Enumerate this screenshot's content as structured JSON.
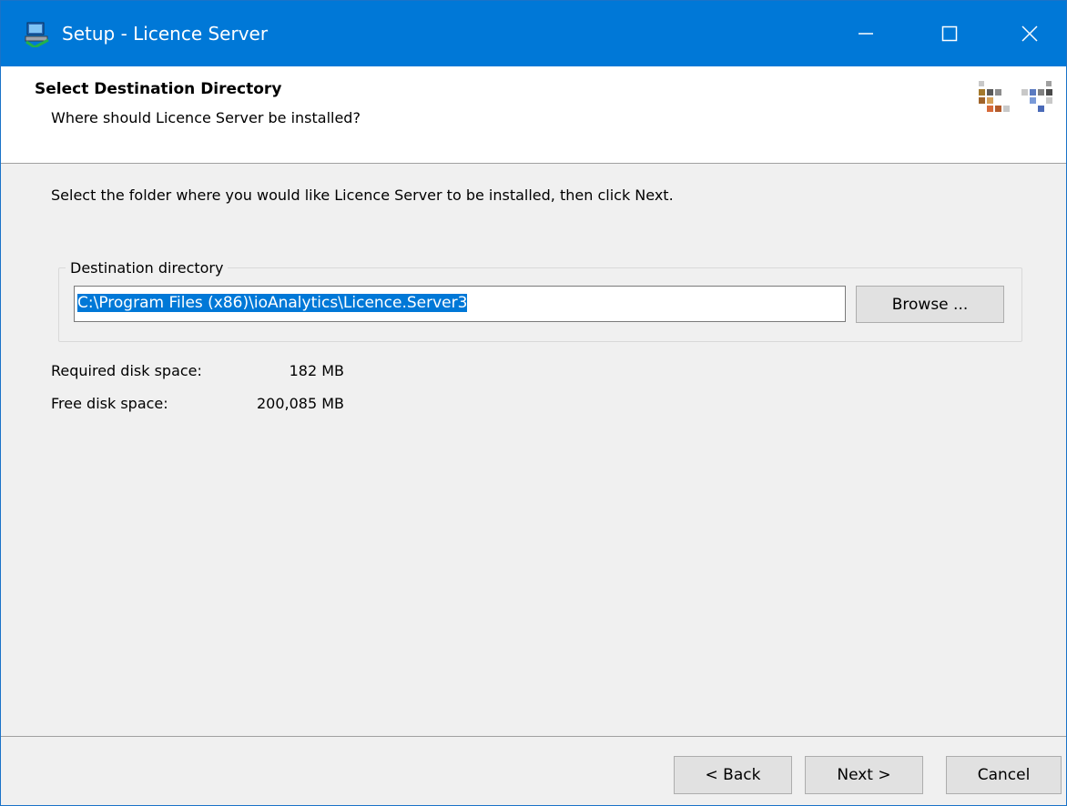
{
  "window": {
    "title": "Setup - Licence Server",
    "accent_color": "#0078d7",
    "icons": {
      "app": "setup-computer-icon",
      "minimize": "minimize-icon",
      "maximize": "maximize-icon",
      "close": "close-icon"
    }
  },
  "header": {
    "title": "Select Destination Directory",
    "subtitle": "Where should Licence Server be installed?",
    "logo": "ioanalytics-logo"
  },
  "main": {
    "instruction": "Select the folder where you would like Licence Server to be installed, then click Next.",
    "group_label": "Destination directory",
    "directory_value": "C:\\Program Files (x86)\\ioAnalytics\\Licence.Server3",
    "browse_label": "Browse ...",
    "required_label": "Required disk space:",
    "required_value": "182 MB",
    "free_label": "Free disk space:",
    "free_value": "200,085 MB"
  },
  "footer": {
    "back_label": "< Back",
    "next_label": "Next >",
    "cancel_label": "Cancel"
  }
}
